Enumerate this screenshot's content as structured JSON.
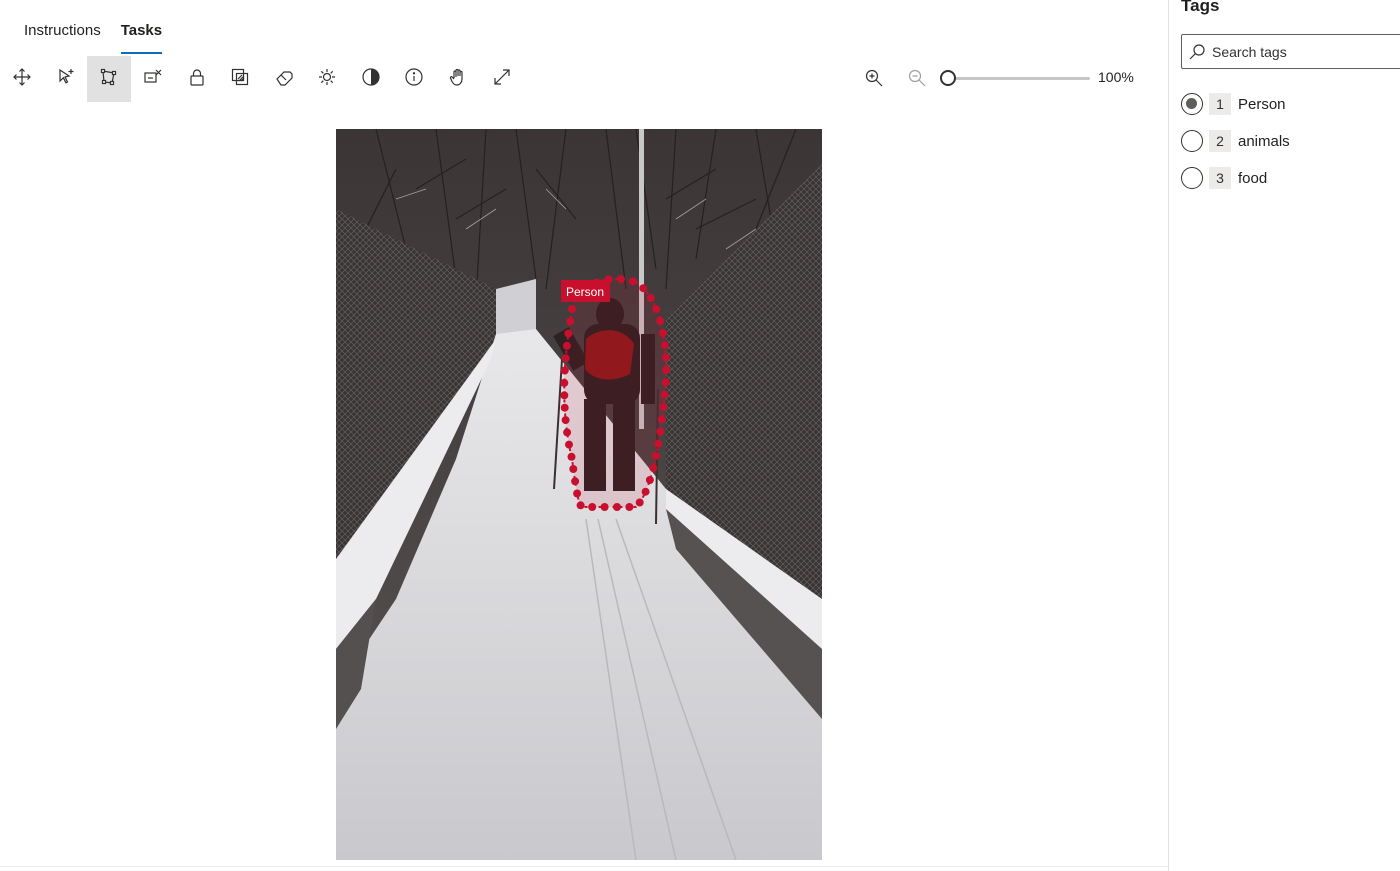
{
  "tabs": [
    {
      "label": "Instructions"
    },
    {
      "label": "Tasks",
      "active": true
    }
  ],
  "toolbar": {
    "tools": [
      {
        "icon": "move-icon"
      },
      {
        "icon": "select-add-icon"
      },
      {
        "icon": "polygon-tool-icon",
        "selected": true
      },
      {
        "icon": "remove-region-icon"
      },
      {
        "icon": "lock-icon"
      },
      {
        "icon": "layers-icon"
      },
      {
        "icon": "eraser-icon"
      },
      {
        "icon": "brightness-icon"
      },
      {
        "icon": "contrast-icon"
      },
      {
        "icon": "info-icon"
      },
      {
        "icon": "pan-hand-icon"
      },
      {
        "icon": "fit-expand-icon"
      }
    ],
    "zoom": {
      "zoom_in_icon": "zoom-in-icon",
      "zoom_out_icon": "zoom-out-icon",
      "value_label": "100%",
      "level_fraction": 0.0
    }
  },
  "canvas": {
    "annotation_label": "Person",
    "annotation_color": "#c8102e"
  },
  "tags_panel": {
    "title": "Tags",
    "search": {
      "placeholder": "Search tags",
      "value": ""
    },
    "tags": [
      {
        "number": "1",
        "label": "Person",
        "selected": true
      },
      {
        "number": "2",
        "label": "animals",
        "selected": false
      },
      {
        "number": "3",
        "label": "food",
        "selected": false
      }
    ]
  },
  "colors": {
    "accent": "#0f6cbd",
    "selected_tool_bg": "#e1e1e1",
    "annotation": "#c8102e"
  }
}
